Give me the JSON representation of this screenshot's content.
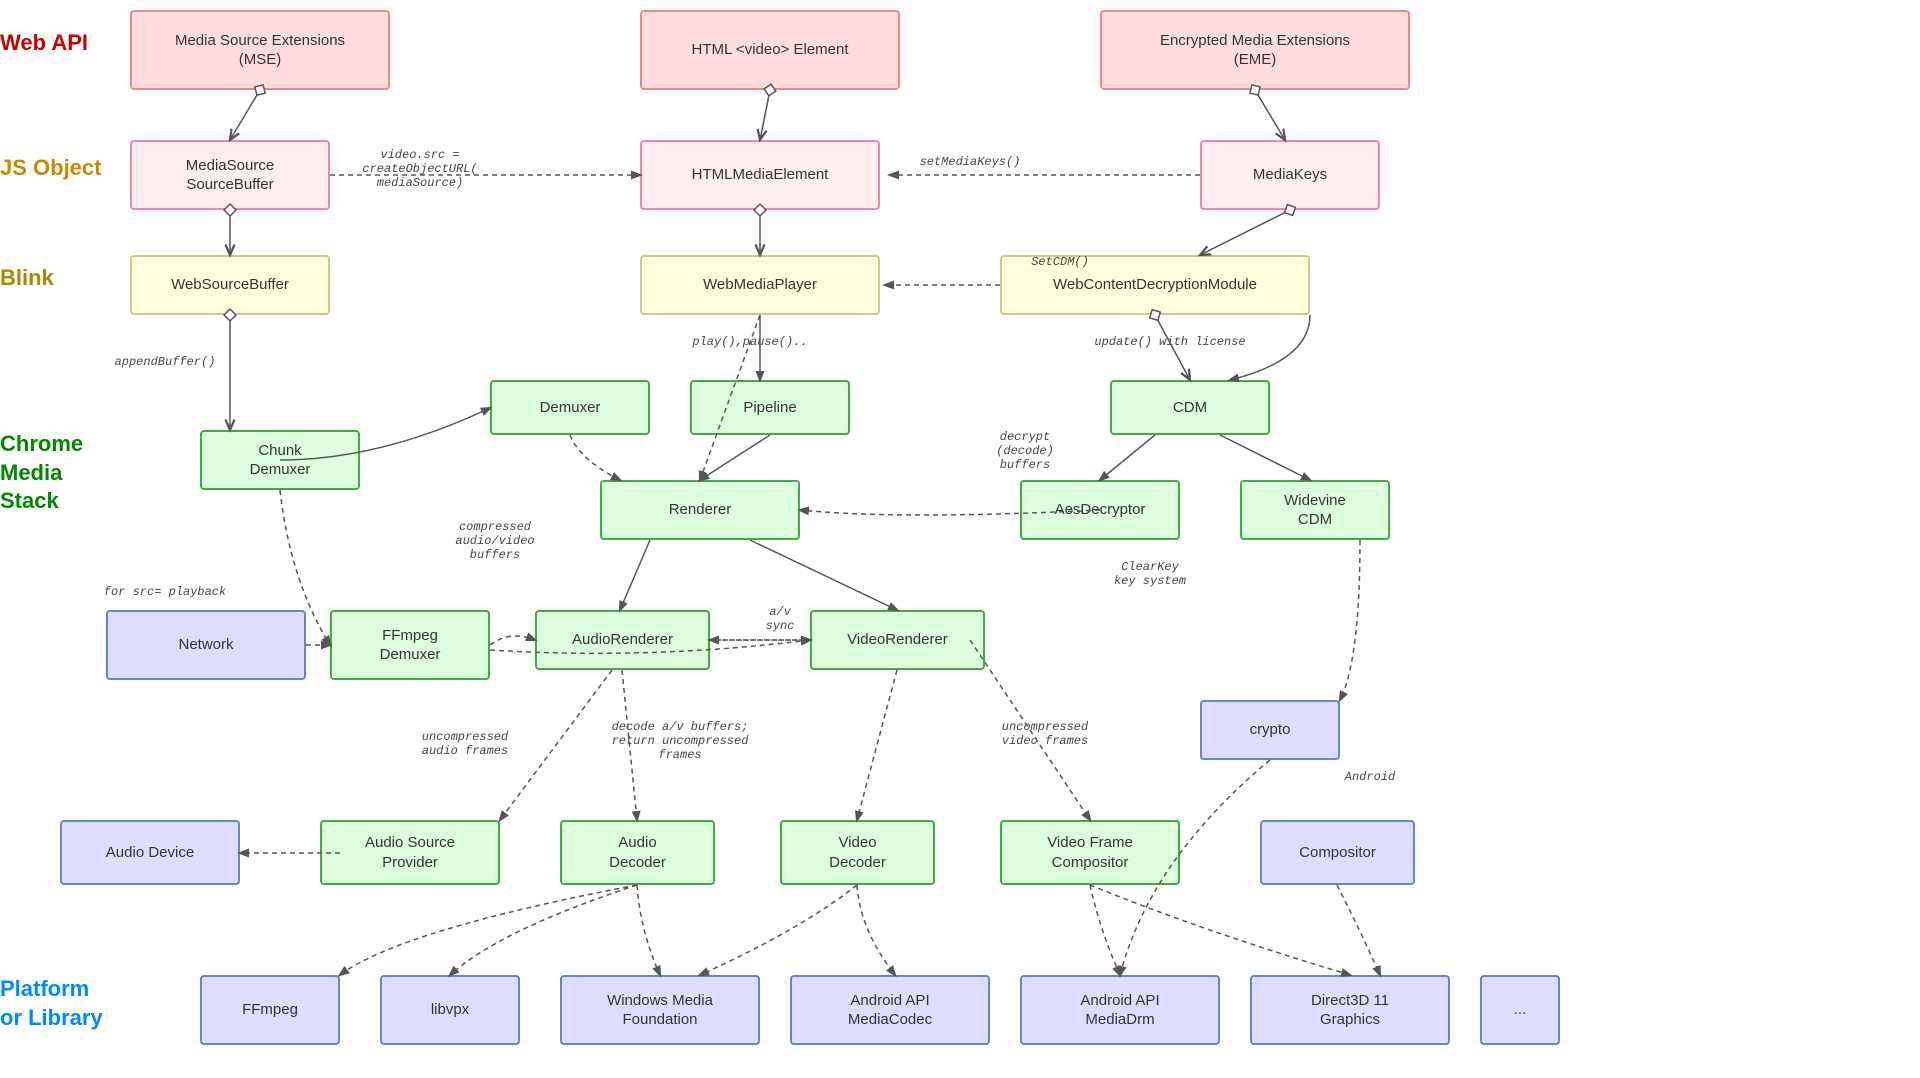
{
  "layers": {
    "web_api": "Web API",
    "js_object": "JS Object",
    "blink": "Blink",
    "chrome_media_stack": "Chrome\nMedia\nStack",
    "platform_or_library": "Platform\nor Library"
  },
  "boxes": {
    "mse": "Media Source Extensions\n(MSE)",
    "html_video": "HTML <video> Element",
    "eme": "Encrypted Media Extensions\n(EME)",
    "mediasource_sourcebuffer": "MediaSource\nSourceBuffer",
    "htmlmediaelement": "HTMLMediaElement",
    "mediakeys": "MediaKeys",
    "websourcebuffer": "WebSourceBuffer",
    "webmediaplayer": "WebMediaPlayer",
    "webcontentdecryptionmodule": "WebContentDecryptionModule",
    "chunk_demuxer": "Chunk\nDemuxer",
    "demuxer": "Demuxer",
    "pipeline": "Pipeline",
    "cdm": "CDM",
    "renderer": "Renderer",
    "aesdecryptor": "AesDecryptor",
    "widevine_cdm": "Widevine\nCDM",
    "network": "Network",
    "ffmpeg_demuxer": "FFmpeg\nDemuxer",
    "audio_renderer": "AudioRenderer",
    "video_renderer": "VideoRenderer",
    "crypto": "crypto",
    "audio_device": "Audio Device",
    "audio_source_provider": "Audio Source\nProvider",
    "audio_decoder": "Audio\nDecoder",
    "video_decoder": "Video\nDecoder",
    "video_frame_compositor": "Video Frame\nCompositor",
    "compositor": "Compositor",
    "ffmpeg": "FFmpeg",
    "libvpx": "libvpx",
    "windows_media_foundation": "Windows Media\nFoundation",
    "android_api_mediacodec": "Android API\nMediaCodec",
    "android_api_mediadrm": "Android API\nMediaDrm",
    "direct3d_11": "Direct3D 11\nGraphics",
    "ellipsis": "..."
  },
  "annotations": {
    "video_src": "video.src =\ncreateObjectURL(\nmediaSource)",
    "set_media_keys": "setMediaKeys()",
    "append_buffer": "appendBuffer()",
    "set_cdm": "SetCDM()",
    "update_with_license": "update() with license",
    "play_pause": "play(),pause()..",
    "decrypt_decode_buffers": "decrypt\n(decode)\nbuffers",
    "compressed_audio_video": "compressed\naudio/video\nbuffers",
    "for_src_playback": "for src= playback",
    "av_sync": "a/v\nsync",
    "uncompressed_audio_frames": "uncompressed\naudio frames",
    "decode_av_buffers": "decode a/v buffers;\nreturn uncompressed\nframes",
    "uncompressed_video_frames": "uncompressed\nvideo frames",
    "clearkey_key_system": "ClearKey\nkey system",
    "android": "Android"
  }
}
